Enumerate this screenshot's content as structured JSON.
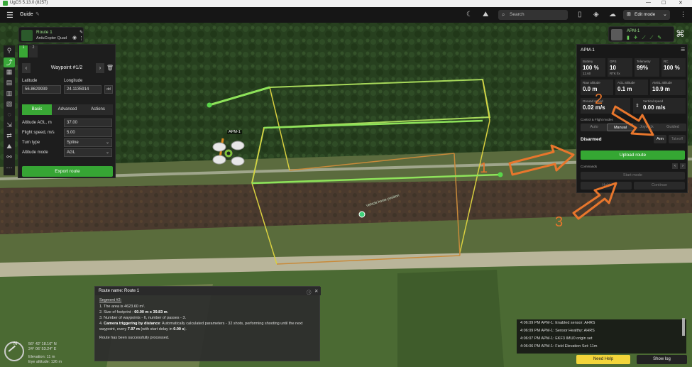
{
  "window": {
    "title": "UgCS 5.13.0 (8257)",
    "controls": [
      "—",
      "☐",
      "✕"
    ]
  },
  "topbar": {
    "menu_icon": "hamburger-icon",
    "screen_title": "Guide",
    "search_placeholder": "Search",
    "edit_mode_label": "Edit mode"
  },
  "route_chip": {
    "name": "Route 1",
    "vehicle": "ArduCopter Quad"
  },
  "mini_tabs": [
    "1",
    "2"
  ],
  "waypoint_panel": {
    "title": "Waypoint #1/2",
    "latitude_label": "Latitude",
    "latitude": "56.8629939",
    "longitude_label": "Longitude",
    "longitude": "24.1135914",
    "unit_toggle": "dd",
    "tabs": [
      "Basic",
      "Advanced",
      "Actions"
    ],
    "selected_tab": "Basic",
    "altitude_label": "Altitude AGL, m",
    "altitude": "37.00",
    "speed_label": "Flight speed, m/s",
    "speed": "5.00",
    "turn_label": "Turn type",
    "turn": "Spline",
    "altmode_label": "Altitude mode",
    "altmode": "AGL",
    "export_label": "Export route"
  },
  "vehicle_chip": {
    "name": "APM-1"
  },
  "apm_panel": {
    "title": "APM-1",
    "tiles": [
      {
        "k": "Battery",
        "v": "100 %",
        "s": "12.60"
      },
      {
        "k": "GPS",
        "v": "10",
        "s": "RTK fix"
      },
      {
        "k": "Telemetry",
        "v": "99%",
        "s": ""
      },
      {
        "k": "RC",
        "v": "100 %",
        "s": ""
      },
      {
        "k": "Raw altitude",
        "v": "0.0 m",
        "s": ""
      },
      {
        "k": "AGL altitude",
        "v": "0.1 m",
        "s": ""
      },
      {
        "k": "AMSL altitude",
        "v": "10.9 m",
        "s": ""
      },
      {
        "k": "Ground speed",
        "v": "0.02 m/s",
        "s": ""
      },
      {
        "k": "Vertical speed",
        "v": "0.00 m/s",
        "s": ""
      }
    ],
    "control_modes_label": "Control & Flight modes",
    "modes": [
      "Auto",
      "Manual",
      "Joystick",
      "Guided"
    ],
    "selected_mode": "Manual",
    "status": "Disarmed",
    "arm_label": "Arm",
    "takeoff_label": "Takeoff",
    "upload_label": "Upload route",
    "commands_label": "Commands",
    "start_mission_label": "Start mode",
    "hold_label": "Hold",
    "continue_label": "Continue"
  },
  "map": {
    "drone_label": "APM-1",
    "home_label": "Vehicle home position"
  },
  "route_info": {
    "title": "Route name: Route 1",
    "segment": "Segment #2:",
    "l1": "1. The area is 4623.60 m².",
    "l2a": "2. Size of footprint - ",
    "l2b": "60.00 m x 39.83 m",
    "l2c": ".",
    "l3": "3. Number of waypoints - 6, number of passes - 3.",
    "l4a": "4. ",
    "l4b": "Camera triggering by distance",
    "l4c": ": Automatically calculated parameters - 32 shots, performing shooting until the next",
    "l5a": "waypoint, every ",
    "l5b": "7.97 m",
    "l5c": " (with start delay in ",
    "l5d": "0.00 s",
    "l5e": ").",
    "done": "Route has been successfully processed."
  },
  "log": [
    "4:06:09 PM  APM-1: Enabled sensor: AHRS",
    "4:06:09 PM  APM-1: Sensor Healthy: AHRS",
    "4:06:07 PM  APM-1: EKF3 IMU0 origin set",
    "4:06:06 PM  APM-1: Field Elevation Set: 11m"
  ],
  "help_label": "Need Help",
  "showlog_label": "Show log",
  "coords": {
    "lat": "56° 42' 18.16\" N",
    "lon": "24° 06' 53.24\" E",
    "elev": "Elevation: 11 m",
    "eye": "Eye altitude: 126 m"
  },
  "compass_n": "N",
  "annotations": [
    "1",
    "2",
    "3"
  ],
  "colors": {
    "accent": "#39a835",
    "route": "#6fd04a",
    "help": "#f3d53a",
    "arrow": "#e8762c"
  }
}
